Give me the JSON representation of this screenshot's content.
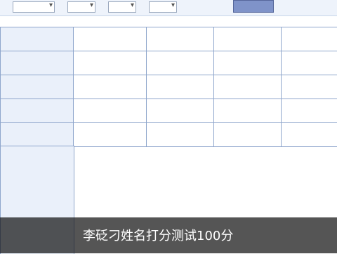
{
  "caption": "李砭刁姓名打分测试100分",
  "selector": {},
  "table": {
    "rows": [
      {
        "label": "",
        "cells": [
          "",
          "",
          "",
          ""
        ]
      },
      {
        "label": "",
        "cells": [
          "",
          "",
          "",
          ""
        ]
      },
      {
        "label": "",
        "cells": [
          "",
          "",
          "",
          ""
        ]
      },
      {
        "label": "",
        "cells": [
          "",
          "",
          "",
          ""
        ]
      },
      {
        "label": "",
        "cells": [
          "",
          "",
          "",
          ""
        ]
      }
    ]
  },
  "analysis": {
    "label": "",
    "text": ""
  }
}
